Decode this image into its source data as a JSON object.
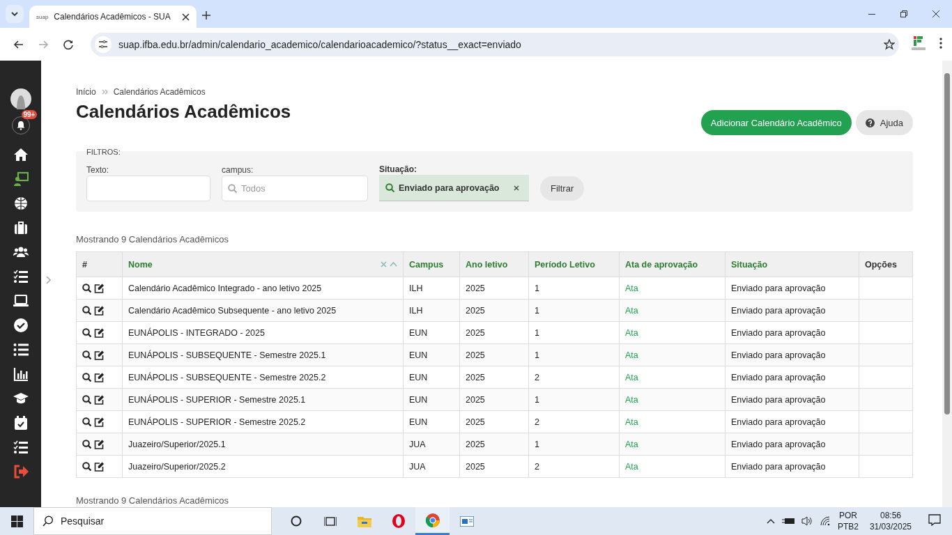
{
  "browser": {
    "tab_title": "Calendários Acadêmicos - SUA",
    "favicon_text": "suap",
    "url": "suap.ifba.edu.br/admin/calendario_academico/calendarioacademico/?status__exact=enviado"
  },
  "sidebar": {
    "notification_badge": "99+"
  },
  "breadcrumbs": [
    "Início",
    "Calendários Acadêmicos"
  ],
  "title": "Calendários Acadêmicos",
  "actions": [
    {
      "label": "Adicionar Calendário Acadêmico",
      "kind": "primary"
    },
    {
      "label": "Ajuda",
      "kind": "help"
    }
  ],
  "filters": {
    "legend": "FILTROS:",
    "fields": [
      {
        "label": "Texto:",
        "kind": "text"
      },
      {
        "label": "campus:",
        "kind": "search",
        "placeholder": "Todos"
      },
      {
        "label": "Situação:",
        "kind": "chip",
        "value": "Enviado para aprovação"
      }
    ],
    "submit": "Filtrar"
  },
  "count_top": "Mostrando 9 Calendários Acadêmicos",
  "table": {
    "columns": [
      "#",
      "Nome",
      "Campus",
      "Ano letivo",
      "Período Letivo",
      "Ata de aprovação",
      "Situação",
      "Opções"
    ],
    "rows": [
      {
        "nome": "Calendário Acadêmico Integrado - ano letivo 2025",
        "campus": "ILH",
        "ano": "2025",
        "periodo": "1",
        "ata": "Ata",
        "situacao": "Enviado para aprovação"
      },
      {
        "nome": "Calendário Acadêmico Subsequente - ano letivo 2025",
        "campus": "ILH",
        "ano": "2025",
        "periodo": "1",
        "ata": "Ata",
        "situacao": "Enviado para aprovação"
      },
      {
        "nome": "EUNÁPOLIS - INTEGRADO - 2025",
        "campus": "EUN",
        "ano": "2025",
        "periodo": "1",
        "ata": "Ata",
        "situacao": "Enviado para aprovação"
      },
      {
        "nome": "EUNÁPOLIS - SUBSEQUENTE - Semestre 2025.1",
        "campus": "EUN",
        "ano": "2025",
        "periodo": "1",
        "ata": "Ata",
        "situacao": "Enviado para aprovação"
      },
      {
        "nome": "EUNÁPOLIS - SUBSEQUENTE - Semestre 2025.2",
        "campus": "EUN",
        "ano": "2025",
        "periodo": "2",
        "ata": "Ata",
        "situacao": "Enviado para aprovação"
      },
      {
        "nome": "EUNÁPOLIS - SUPERIOR - Semestre 2025.1",
        "campus": "EUN",
        "ano": "2025",
        "periodo": "1",
        "ata": "Ata",
        "situacao": "Enviado para aprovação"
      },
      {
        "nome": "EUNÁPOLIS - SUPERIOR - Semestre 2025.2",
        "campus": "EUN",
        "ano": "2025",
        "periodo": "2",
        "ata": "Ata",
        "situacao": "Enviado para aprovação"
      },
      {
        "nome": "Juazeiro/Superior/2025.1",
        "campus": "JUA",
        "ano": "2025",
        "periodo": "1",
        "ata": "Ata",
        "situacao": "Enviado para aprovação"
      },
      {
        "nome": "Juazeiro/Superior/2025.2",
        "campus": "JUA",
        "ano": "2025",
        "periodo": "2",
        "ata": "Ata",
        "situacao": "Enviado para aprovação"
      }
    ]
  },
  "count_bottom": "Mostrando 9 Calendários Acadêmicos",
  "taskbar": {
    "search": "Pesquisar",
    "lang": "POR",
    "layout": "PTB2",
    "time": "08:56",
    "date": "31/03/2025"
  }
}
